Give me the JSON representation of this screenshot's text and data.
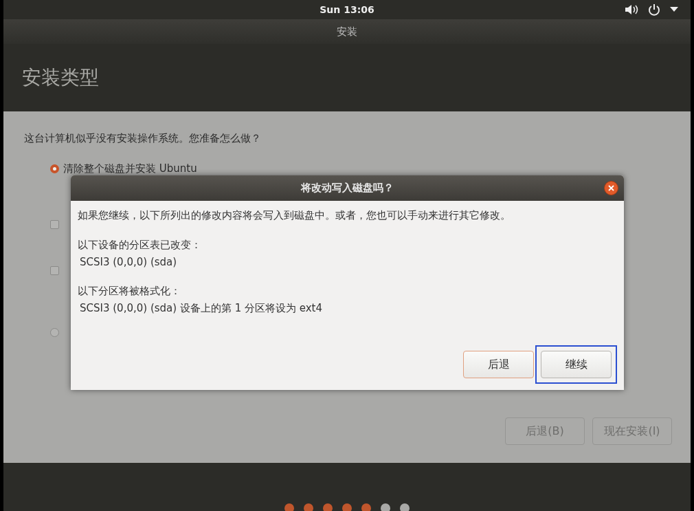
{
  "top_bar": {
    "clock": "Sun 13:06"
  },
  "window": {
    "title": "安装",
    "heading": "安装类型"
  },
  "content": {
    "question": "这台计算机似乎没有安装操作系统。您准备怎么做？",
    "options": [
      {
        "kind": "radio",
        "label": "清除整个磁盘并安装 Ubuntu",
        "selected": true
      },
      {
        "kind": "checkbox",
        "checked": false
      },
      {
        "kind": "checkbox",
        "checked": false
      },
      {
        "kind": "radio",
        "selected": false
      }
    ],
    "buttons": [
      {
        "label": "后退(B)"
      },
      {
        "label": "现在安装(I)"
      }
    ]
  },
  "dialog": {
    "title": "将改动写入磁盘吗？",
    "message": "如果您继续，以下所列出的修改内容将会写入到磁盘中。或者，您也可以手动来进行其它修改。",
    "sections": [
      {
        "heading": "以下设备的分区表已改变：",
        "detail": "SCSI3 (0,0,0) (sda)"
      },
      {
        "heading": "以下分区将被格式化：",
        "detail": "SCSI3 (0,0,0) (sda) 设备上的第 1 分区将设为 ext4"
      }
    ],
    "buttons": [
      {
        "kind": "cancel",
        "label": "后退"
      },
      {
        "kind": "default",
        "label": "继续"
      }
    ]
  },
  "progress": [
    {
      "done": true
    },
    {
      "done": true
    },
    {
      "done": true
    },
    {
      "done": true
    },
    {
      "done": true
    },
    {
      "done": false
    },
    {
      "done": false
    }
  ]
}
